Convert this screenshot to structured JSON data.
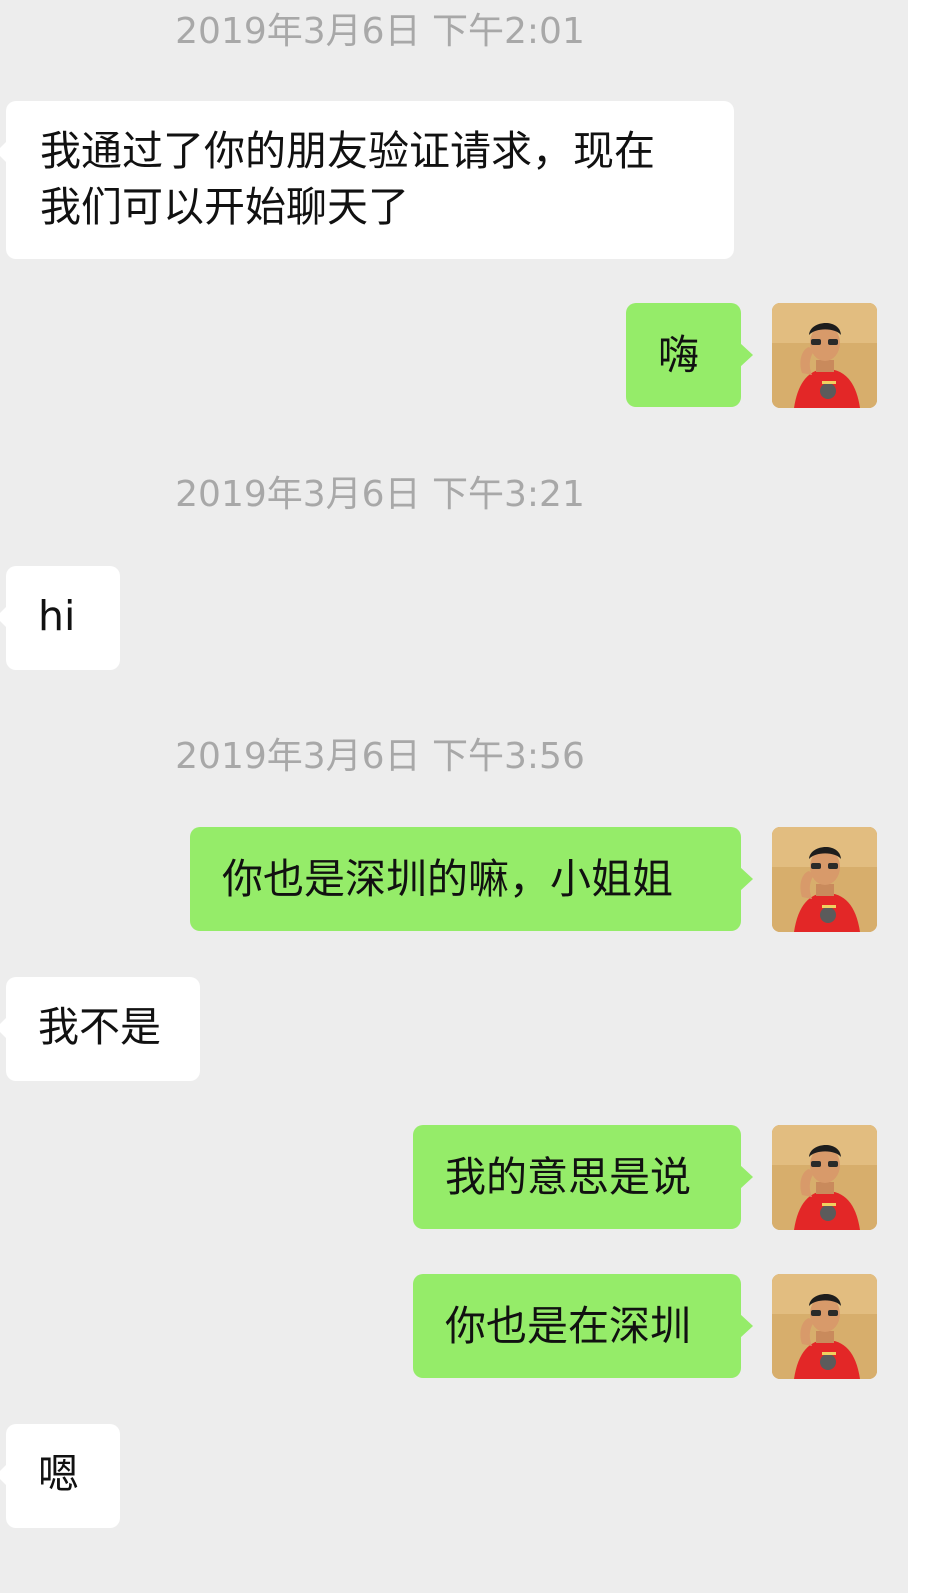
{
  "timestamps": [
    "2019年3月6日 下午2:01",
    "2019年3月6日 下午3:21",
    "2019年3月6日 下午3:56"
  ],
  "messages": [
    {
      "side": "in",
      "text": "我通过了你的朋友验证请求，现在\n我们可以开始聊天了"
    },
    {
      "side": "out",
      "text": "嗨"
    },
    {
      "side": "in",
      "text": "hi"
    },
    {
      "side": "out",
      "text": "你也是深圳的嘛，小姐姐"
    },
    {
      "side": "in",
      "text": "我不是"
    },
    {
      "side": "out",
      "text": "我的意思是说"
    },
    {
      "side": "out",
      "text": "你也是在深圳"
    },
    {
      "side": "in",
      "text": "嗯"
    }
  ],
  "colors": {
    "chat_background": "#ededed",
    "incoming_bubble": "#ffffff",
    "outgoing_bubble": "#95ec69",
    "timestamp_text": "#a8a8a8"
  },
  "icons": {
    "avatar": "user-avatar-photo"
  }
}
